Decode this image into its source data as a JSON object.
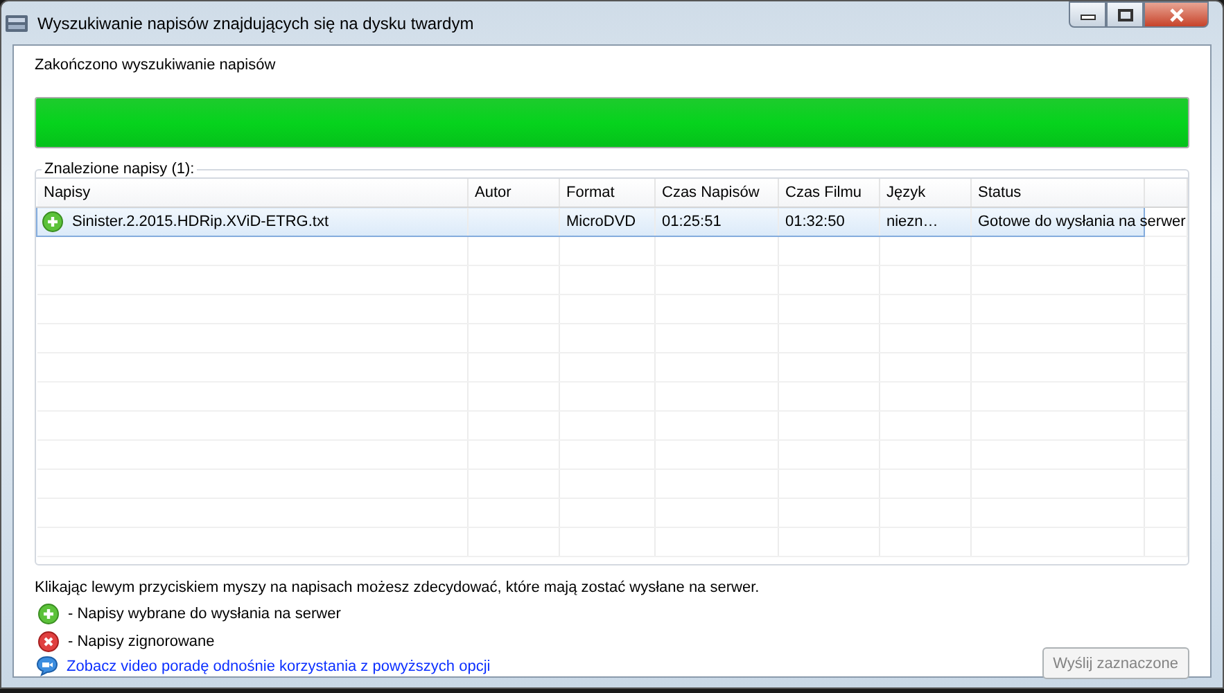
{
  "window": {
    "title": "Wyszukiwanie napisów znajdujących się na dysku twardym"
  },
  "status_text": "Zakończono wyszukiwanie napisów",
  "progress": {
    "level": 1.0
  },
  "results": {
    "title": "Znalezione napisy (1):",
    "columns": [
      "Napisy",
      "Autor",
      "Format",
      "Czas Napisów",
      "Czas Filmu",
      "Język",
      "Status"
    ],
    "rows": [
      {
        "kind": "add",
        "selected": true,
        "cells": [
          "Sinister.2.2015.HDRip.XViD-ETRG.txt",
          "",
          "MicroDVD",
          "01:25:51",
          "01:32:50",
          "niezn…",
          "Gotowe do wysłania na serwer"
        ]
      }
    ]
  },
  "hint": "Klikając lewym przyciskiem myszy na napisach możesz zdecydować, które mają zostać wysłane na serwer.",
  "legend": [
    {
      "kind": "add",
      "text": "- Napisy wybrane do wysłania na serwer"
    },
    {
      "kind": "ignore",
      "text": "- Napisy zignorowane"
    }
  ],
  "video_link": "Zobacz video poradę odnośnie korzystania z powyższych opcji",
  "send_button": {
    "label": "Wyślij zaznaczone",
    "disabled": true
  }
}
